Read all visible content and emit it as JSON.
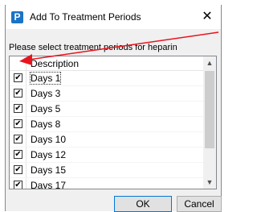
{
  "dialog": {
    "app_icon_letter": "P",
    "title": "Add To Treatment Periods",
    "close_glyph": "✕",
    "prompt": "Please select treatment periods for heparin"
  },
  "list": {
    "header": "Description",
    "rows": [
      {
        "label": "Days 1",
        "checked": true
      },
      {
        "label": "Days 3",
        "checked": true
      },
      {
        "label": "Days 5",
        "checked": true
      },
      {
        "label": "Days 8",
        "checked": true
      },
      {
        "label": "Days 10",
        "checked": true
      },
      {
        "label": "Days 12",
        "checked": true
      },
      {
        "label": "Days 15",
        "checked": true
      },
      {
        "label": "Days 17",
        "checked": true
      }
    ],
    "check_glyph": "✔",
    "scroll_up_glyph": "▲",
    "scroll_down_glyph": "▼"
  },
  "buttons": {
    "ok": "OK",
    "cancel": "Cancel"
  },
  "annotation": {
    "arrow_color": "#e8141e"
  }
}
